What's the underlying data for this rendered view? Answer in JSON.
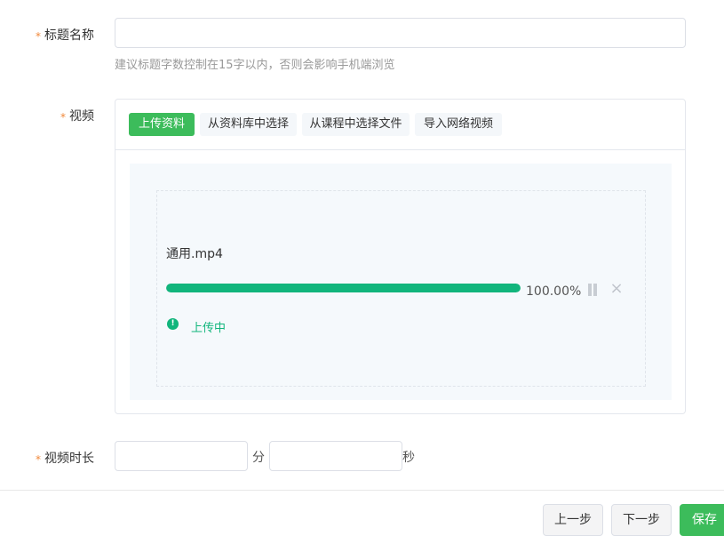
{
  "form": {
    "title_field": {
      "required_mark": "*",
      "label": "标题名称",
      "value": "",
      "placeholder": "",
      "hint": "建议标题字数控制在15字以内，否则会影响手机端浏览"
    },
    "video_field": {
      "required_mark": "*",
      "label": "视频",
      "tabs": [
        {
          "label": "上传资料",
          "active": true
        },
        {
          "label": "从资料库中选择",
          "active": false
        },
        {
          "label": "从课程中选择文件",
          "active": false
        },
        {
          "label": "导入网络视频",
          "active": false
        }
      ],
      "upload": {
        "file_name": "通用.mp4",
        "progress_percent": 100,
        "progress_text": "100.00%",
        "status_icon": "info-circle-icon",
        "status_text": "上传中",
        "pause_icon": "pause-icon",
        "close_icon": "close-icon"
      }
    },
    "duration_field": {
      "required_mark": "*",
      "label": "视频时长",
      "minutes_value": "",
      "minutes_unit": "分",
      "seconds_value": "",
      "seconds_unit": "秒"
    }
  },
  "footer": {
    "prev_label": "上一步",
    "next_label": "下一步",
    "save_label": "保存"
  },
  "colors": {
    "accent_green": "#3cbc5b",
    "progress_green": "#11b57c",
    "required_star": "#f0883a"
  }
}
